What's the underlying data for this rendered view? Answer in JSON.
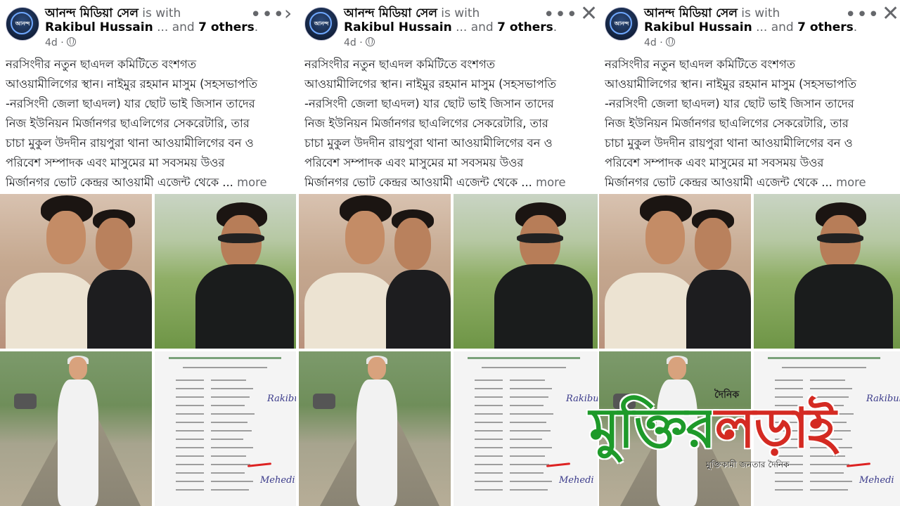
{
  "posts": [
    {
      "page_name": "আনন্দ মিডিয়া সেল",
      "with_text": "is with",
      "tagged_name": "Rakibul Hussain",
      "and_text": "... and",
      "others_text": "7 others",
      "period": ".",
      "time": "4d",
      "time_sep": "·",
      "header_action": "›",
      "body_lines": [
        "নরসিংদীর নতুন ছাএদল কমিটিতে বংশগত",
        "আওয়ামীলিগের স্থান। নাইমুর রহমান মাসুম (সহসভাপতি",
        "-নরসিংদী জেলা ছাএদল) যার ছোট ভাই জিসান তাদের",
        "নিজ ইউনিয়ন মির্জানগর ছাএলিগের সেকরেটারি, তার",
        "চাচা মুকুল উদদীন রায়পুরা থানা আওয়ামীলিগের বন ও",
        "পরিবেশ সম্পাদক এবং মাসুমের মা সবসময় উওর",
        "মির্জানগর ভোট কেন্দ্রর আওয়ামী এজেন্ট থেকে ..."
      ],
      "more_label": "more"
    },
    {
      "page_name": "আনন্দ মিডিয়া সেল",
      "with_text": "is with",
      "tagged_name": "Rakibul Hussain",
      "and_text": "... and",
      "others_text": "7 others",
      "period": ".",
      "time": "4d",
      "time_sep": "·",
      "header_action": "✕",
      "body_lines": [
        "নরসিংদীর নতুন ছাএদল কমিটিতে বংশগত",
        "আওয়ামীলিগের স্থান। নাইমুর রহমান মাসুম (সহসভাপতি",
        "-নরসিংদী জেলা ছাএদল) যার ছোট ভাই জিসান তাদের",
        "নিজ ইউনিয়ন মির্জানগর ছাএলিগের সেকরেটারি, তার",
        "চাচা মুকুল উদদীন রায়পুরা থানা আওয়ামীলিগের বন ও",
        "পরিবেশ সম্পাদক এবং মাসুমের মা সবসময় উওর",
        "মির্জানগর ভোট কেন্দ্রর আওয়ামী এজেন্ট থেকে ..."
      ],
      "more_label": "more"
    },
    {
      "page_name": "আনন্দ মিডিয়া সেল",
      "with_text": "is with",
      "tagged_name": "Rakibul Hussain",
      "and_text": "... and",
      "others_text": "7 others",
      "period": ".",
      "time": "4d",
      "time_sep": "·",
      "header_action": "✕",
      "body_lines": [
        "নরসিংদীর নতুন ছাএদল কমিটিতে বংশগত",
        "আওয়ামীলিগের স্থান। নাইমুর রহমান মাসুম (সহসভাপতি",
        "-নরসিংদী জেলা ছাএদল) যার ছোট ভাই জিসান তাদের",
        "নিজ ইউনিয়ন মির্জানগর ছাএলিগের সেকরেটারি, তার",
        "চাচা মুকুল উদদীন রায়পুরা থানা আওয়ামীলিগের বন ও",
        "পরিবেশ সম্পাদক এবং মাসুমের মা সবসময় উওর",
        "মির্জানগর ভোট কেন্দ্রর আওয়ামী এজেন্ট থেকে ..."
      ],
      "more_label": "more"
    }
  ],
  "icons": {
    "menu": "more-options-icon",
    "privacy": "globe-icon",
    "close": "close-icon",
    "next": "chevron-right-icon"
  },
  "watermark": {
    "prefix": "দৈনিক",
    "title_green": "মুক্তির",
    "title_red": "লড়াই",
    "tagline": "মুক্তিকামী জনতার দৈনিক",
    "color_green": "#1e9a2a",
    "color_red": "#d42a22"
  }
}
